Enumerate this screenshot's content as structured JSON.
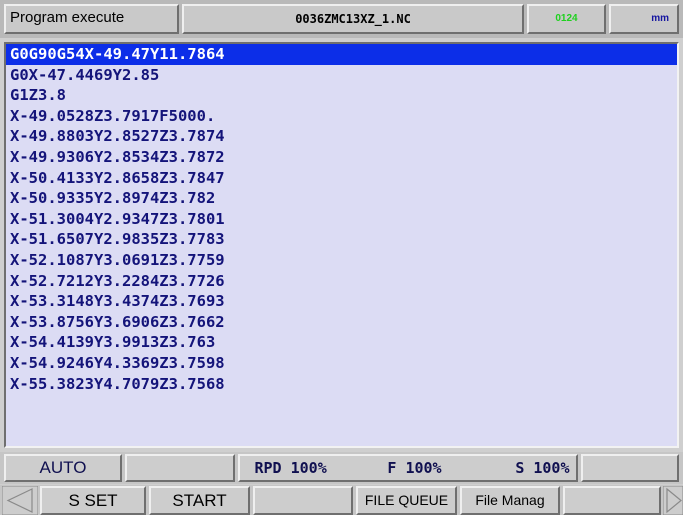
{
  "header": {
    "title": "Program execute",
    "filename": "0036ZMC13XZ_1.NC",
    "indicator": "0124",
    "unit": "mm"
  },
  "program_lines": [
    "G0G90G54X-49.47Y11.7864",
    "G0X-47.4469Y2.85",
    "G1Z3.8",
    "X-49.0528Z3.7917F5000.",
    "X-49.8803Y2.8527Z3.7874",
    "X-49.9306Y2.8534Z3.7872",
    "X-50.4133Y2.8658Z3.7847",
    "X-50.9335Y2.8974Z3.782",
    "X-51.3004Y2.9347Z3.7801",
    "X-51.6507Y2.9835Z3.7783",
    "X-52.1087Y3.0691Z3.7759",
    "X-52.7212Y3.2284Z3.7726",
    "X-53.3148Y3.4374Z3.7693",
    "X-53.8756Y3.6906Z3.7662",
    "X-54.4139Y3.9913Z3.763",
    "X-54.9246Y4.3369Z3.7598",
    "X-55.3823Y4.7079Z3.7568"
  ],
  "selected_line": 0,
  "status": {
    "mode": "AUTO",
    "rapid": "RPD 100%",
    "feed": "F 100%",
    "spindle": "S 100%"
  },
  "softkeys": {
    "key1": "S SET",
    "key2": "START",
    "key3": "",
    "key4": "FILE QUEUE",
    "key5": "File Manag",
    "key6": ""
  },
  "icons": {
    "left": "left-arrow-icon",
    "right": "right-arrow-icon"
  },
  "colors": {
    "selection": "#0c2ee8",
    "program_bg": "#dcdcf4",
    "indicator": "#1fd11f"
  }
}
